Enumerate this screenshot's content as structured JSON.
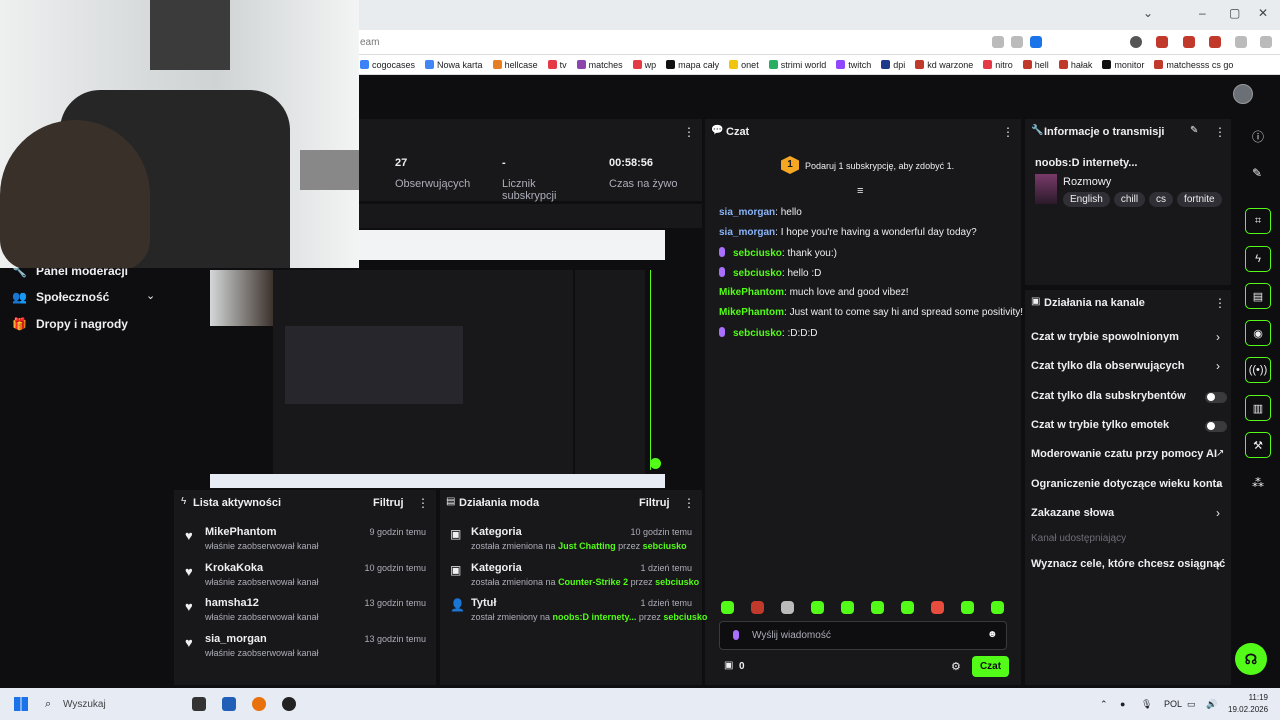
{
  "browser": {
    "address_fragment": "eam",
    "bookmarks": [
      {
        "label": "cogocases",
        "color": "#3b82f6"
      },
      {
        "label": "Nowa karta",
        "color": "#4285f4"
      },
      {
        "label": "hellcase",
        "color": "#e67e22"
      },
      {
        "label": "tv",
        "color": "#e63946"
      },
      {
        "label": "matches",
        "color": "#8e44ad"
      },
      {
        "label": "wp",
        "color": "#e63946"
      },
      {
        "label": "mapa cały",
        "color": "#111111"
      },
      {
        "label": "onet",
        "color": "#f1c40f"
      },
      {
        "label": "strimi world",
        "color": "#27ae60"
      },
      {
        "label": "twitch",
        "color": "#9146ff"
      },
      {
        "label": "dpi",
        "color": "#1e3a8a"
      },
      {
        "label": "kd warzone",
        "color": "#c0392b"
      },
      {
        "label": "nitro",
        "color": "#e63946"
      },
      {
        "label": "hell",
        "color": "#c0392b"
      },
      {
        "label": "hałak",
        "color": "#c0392b"
      },
      {
        "label": "monitor",
        "color": "#111111"
      },
      {
        "label": "matchesss cs go",
        "color": "#c0392b"
      }
    ]
  },
  "sidebar": {
    "items": [
      {
        "label": "Panel moderacji",
        "icon": "wrench-icon"
      },
      {
        "label": "Społeczność",
        "icon": "community-icon"
      },
      {
        "label": "Dropy i nagrody",
        "icon": "gift-icon"
      }
    ]
  },
  "stats": [
    {
      "value": "27",
      "label": "Obserwujących"
    },
    {
      "value": "-",
      "label": "Licznik subskrypcji"
    },
    {
      "value": "00:58:56",
      "label": "Czas na żywo"
    }
  ],
  "chat": {
    "title": "Czat",
    "gift_text": "Podaruj 1 subskrypcję, aby zdobyć 1.",
    "gift_badge": "1",
    "messages": [
      {
        "user": "sia_morgan",
        "text": ": hello",
        "style": "blue",
        "mic": false
      },
      {
        "user": "sia_morgan",
        "text": ": I hope you're having a wonderful day today?",
        "style": "blue",
        "mic": false
      },
      {
        "user": "sebciusko",
        "text": ": thank you:)",
        "style": "green",
        "mic": true
      },
      {
        "user": "sebciusko",
        "text": ": hello :D",
        "style": "green",
        "mic": true
      },
      {
        "user": "MikePhantom",
        "text": ": much love and good vibez!",
        "style": "green",
        "mic": false
      },
      {
        "user": "MikePhantom",
        "text": ": Just want to come say hi and spread some positivity!",
        "style": "green",
        "mic": false
      },
      {
        "user": "sebciusko",
        "text": ": :D:D:D",
        "style": "green",
        "mic": true
      }
    ],
    "input_placeholder": "Wyślij wiadomość",
    "points": "0",
    "send_label": "Czat"
  },
  "stream_info": {
    "title": "Informacje o transmisji",
    "stream_title": "noobs:D internety...",
    "category": "Rozmowy",
    "tags": [
      "English",
      "chill",
      "cs",
      "fortnite"
    ]
  },
  "channel_actions": {
    "title": "Działania na kanale",
    "items": [
      {
        "label": "Czat w trybie spowolnionym",
        "control": "chevron"
      },
      {
        "label": "Czat tylko dla obserwujących",
        "control": "chevron"
      },
      {
        "label": "Czat tylko dla subskrybentów",
        "control": "toggle"
      },
      {
        "label": "Czat w trybie tylko emotek",
        "control": "toggle"
      },
      {
        "label": "Moderowanie czatu przy pomocy AI",
        "control": "external"
      },
      {
        "label": "Ograniczenie dotyczące wieku konta",
        "control": "chevron"
      },
      {
        "label": "Zakazane słowa",
        "control": "chevron"
      }
    ],
    "shared_channel_label": "Kanał udostępniający",
    "goals_label": "Wyznacz cele, które chcesz osiągnąć"
  },
  "activity": {
    "title": "Lista aktywności",
    "filter_label": "Filtruj",
    "items": [
      {
        "name": "MikePhantom",
        "sub": "właśnie zaobserwował kanał",
        "time": "9 godzin temu"
      },
      {
        "name": "KrokaKoka",
        "sub": "właśnie zaobserwował kanał",
        "time": "10 godzin temu"
      },
      {
        "name": "hamsha12",
        "sub": "właśnie zaobserwował kanał",
        "time": "13 godzin temu"
      },
      {
        "name": "sia_morgan",
        "sub": "właśnie zaobserwował kanał",
        "time": "13 godzin temu"
      }
    ]
  },
  "mod_actions": {
    "title": "Działania moda",
    "filter_label": "Filtruj",
    "items": [
      {
        "name": "Kategoria",
        "pre": "została zmieniona na ",
        "value": "Just Chatting",
        "mid": " przez ",
        "by": "sebciusko",
        "time": "10 godzin temu"
      },
      {
        "name": "Kategoria",
        "pre": "została zmieniona na ",
        "value": "Counter-Strike 2",
        "mid": " przez ",
        "by": "sebciusko",
        "time": "1 dzień temu"
      },
      {
        "name": "Tytuł",
        "pre": "został zmieniony na ",
        "value": "noobs:D internety...",
        "mid": " przez ",
        "by": "sebciusko",
        "time": "1 dzień temu"
      }
    ]
  },
  "taskbar": {
    "search_placeholder": "Wyszukaj",
    "lang": "POL",
    "time": "11:19",
    "date": "19.02.2026"
  },
  "colors": {
    "accent": "#53fc18",
    "panel": "#18181b",
    "background": "#0e0e10"
  }
}
